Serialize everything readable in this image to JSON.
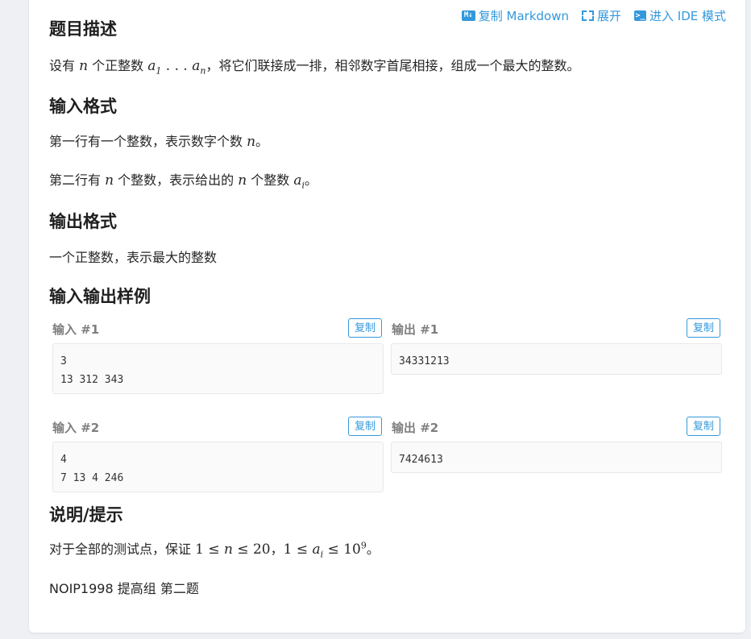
{
  "toolbar": {
    "markdown_badge": "M↓",
    "copy_markdown_label": "复制 Markdown",
    "expand_label": "展开",
    "ide_badge": ">_",
    "ide_label": "进入 IDE 模式"
  },
  "description": {
    "heading": "题目描述",
    "text_1": "设有 ",
    "math_n": "n",
    "text_2": " 个正整数 ",
    "math_a": "a",
    "sub_1": "1",
    "math_dots": " . . . ",
    "sub_n": "n",
    "text_3": "，将它们联接成一排，相邻数字首尾相接，组成一个最大的整数。"
  },
  "input_format": {
    "heading": "输入格式",
    "line1_text": "第一行有一个整数，表示数字个数 ",
    "line1_math": "n",
    "line1_end": "。",
    "line2_text_a": "第二行有 ",
    "line2_math_n": "n",
    "line2_text_b": " 个整数，表示给出的 ",
    "line2_math_n2": "n",
    "line2_text_c": " 个整数 ",
    "line2_math_a": "a",
    "line2_sub_i": "i",
    "line2_end": "。"
  },
  "output_format": {
    "heading": "输出格式",
    "text": "一个正整数，表示最大的整数"
  },
  "samples": {
    "heading": "输入输出样例",
    "copy_label": "复制",
    "items": [
      {
        "input_label": "输入 #1",
        "input_lines": [
          "3",
          "13 312 343"
        ],
        "output_label": "输出 #1",
        "output_lines": [
          "34331213"
        ]
      },
      {
        "input_label": "输入 #2",
        "input_lines": [
          "4",
          "7 13 4 246"
        ],
        "output_label": "输出 #2",
        "output_lines": [
          "7424613"
        ]
      }
    ]
  },
  "hint": {
    "heading": "说明/提示",
    "text_1": "对于全部的测试点，保证 ",
    "math_1": "1 ≤ ",
    "math_n": "n",
    "math_2": " ≤ 20",
    "sep": "，",
    "math_3": "1 ≤ ",
    "math_a": "a",
    "sub_i": "i",
    "math_4": " ≤ 10",
    "sup_9": "9",
    "end": "。"
  },
  "source": {
    "text": "NOIP1998 提高组 第二题"
  },
  "colors": {
    "accent": "#3498db",
    "label_gray": "#7f7f7f",
    "page_bg": "#eef0f3"
  }
}
